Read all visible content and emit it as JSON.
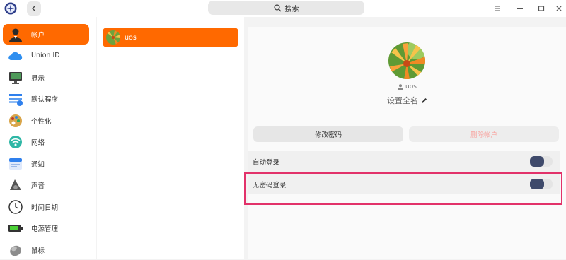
{
  "search": {
    "label": "搜索"
  },
  "nav": {
    "items": [
      {
        "label": "帐户",
        "icon": "account-icon",
        "active": true
      },
      {
        "label": "Union ID",
        "icon": "cloud-icon"
      },
      {
        "label": "显示",
        "icon": "display-icon"
      },
      {
        "label": "默认程序",
        "icon": "default-apps-icon"
      },
      {
        "label": "个性化",
        "icon": "personalization-icon"
      },
      {
        "label": "网络",
        "icon": "network-icon"
      },
      {
        "label": "通知",
        "icon": "notification-icon"
      },
      {
        "label": "声音",
        "icon": "sound-icon"
      },
      {
        "label": "时间日期",
        "icon": "clock-icon"
      },
      {
        "label": "电源管理",
        "icon": "battery-icon"
      },
      {
        "label": "鼠标",
        "icon": "mouse-icon"
      }
    ]
  },
  "accounts": [
    {
      "name": "uos"
    }
  ],
  "detail": {
    "username": "uos",
    "fullname_placeholder": "设置全名",
    "change_password_label": "修改密码",
    "delete_account_label": "删除帐户",
    "settings": [
      {
        "label": "自动登录",
        "enabled": true
      },
      {
        "label": "无密码登录",
        "enabled": true
      }
    ]
  },
  "colors": {
    "accent": "#ff6900",
    "toggle": "#3f4a6b",
    "highlight": "#e2326a"
  }
}
